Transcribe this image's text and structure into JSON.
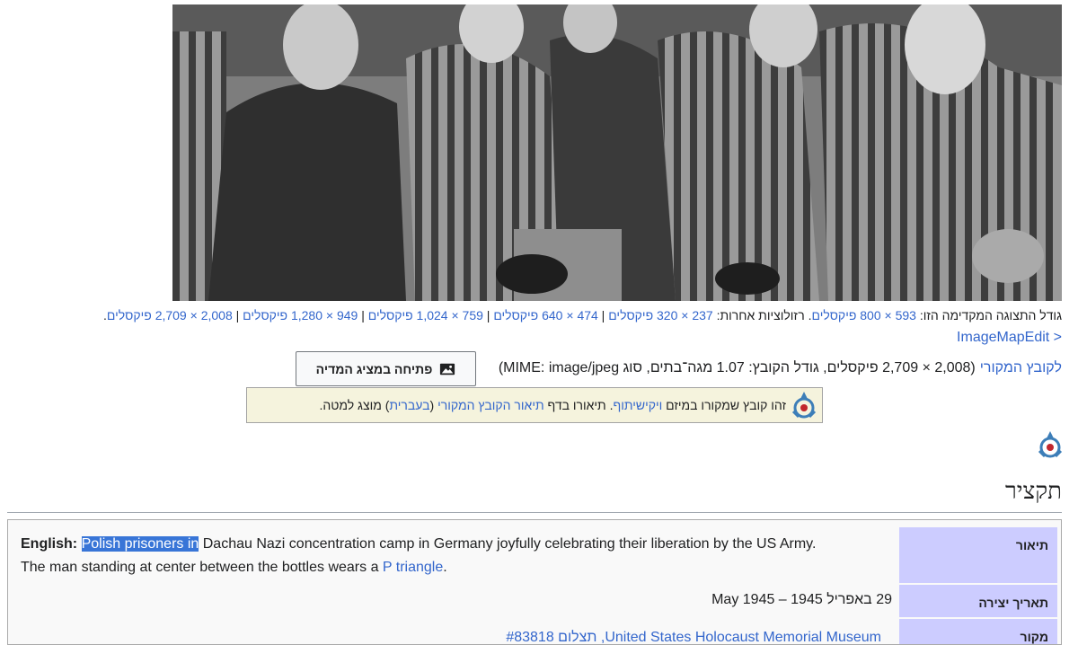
{
  "image": {
    "alt_icon": "photo-of-smiling-prisoners"
  },
  "resolutions": {
    "preview_label": "גודל התצוגה המקדימה הזו:",
    "preview_size": "593 × 800 פיקסלים",
    "other_label": ". רזולוציות אחרות:",
    "sizes": [
      "237 × 320 פיקסלים",
      "474 × 640 פיקסלים",
      "759 × 1,024 פיקסלים",
      "949 × 1,280 פיקסלים",
      "2,008 × 2,709 פיקסלים"
    ],
    "separator": " | ",
    "trailing": "."
  },
  "imagemapedit": "ImageMapEdit >",
  "file_info": {
    "link": "לקובץ המקורי",
    "details": "(2,008 × 2,709 פיקסלים, גודל הקובץ: 1.07 מגה־בתים, סוג MIME: image/jpeg)"
  },
  "viewer_button": {
    "label": "פתיחה במציג המדיה",
    "icon": "image-icon"
  },
  "commons_note": {
    "text_1": "זהו קובץ שמקורו במיזם",
    "link_1": "ויקישיתוף",
    "text_2": ". תיאורו בדף",
    "link_2": "תיאור הקובץ המקורי",
    "text_3": "(",
    "link_3": "בעברית",
    "text_4": ") מוצג למטה.",
    "icon": "commons-logo-icon"
  },
  "section": {
    "title": "תקציר"
  },
  "summary": {
    "description_label": "תיאור",
    "desc_lang": "English:",
    "desc_highlight": "Polish prisoners in",
    "desc_rest": " Dachau Nazi concentration camp in Germany joyfully celebrating their liberation by the US Army.",
    "desc_line2": "The man standing at center between the bottles wears a",
    "desc_link": "P triangle",
    "desc_end": ".",
    "date_label": "תאריך יצירה",
    "date_value": "29 באפריל 1945 – May 1945",
    "source_label": "מקור",
    "source_text": "United States Holocaust Memorial Museum, תצלום #83818"
  },
  "colors": {
    "link": "#3366cc",
    "label_bg": "#ccccff",
    "note_bg": "#f5f3dd",
    "highlight": "#3875d7"
  }
}
